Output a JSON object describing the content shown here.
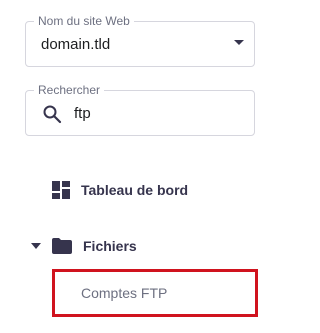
{
  "site_select": {
    "label": "Nom du site Web",
    "value": "domain.tld"
  },
  "search": {
    "label": "Rechercher",
    "value": "ftp"
  },
  "menu": {
    "dashboard_label": "Tableau de bord",
    "files_label": "Fichiers",
    "ftp_accounts_label": "Comptes FTP"
  },
  "icons": {
    "dropdown": "chevron-down-icon",
    "search": "search-icon",
    "dashboard": "dashboard-icon",
    "expand": "expand-triangle-icon",
    "folder": "folder-icon"
  },
  "colors": {
    "highlight_border": "#d0131e",
    "text_dark": "#36344d",
    "text_muted": "#6d7081"
  }
}
